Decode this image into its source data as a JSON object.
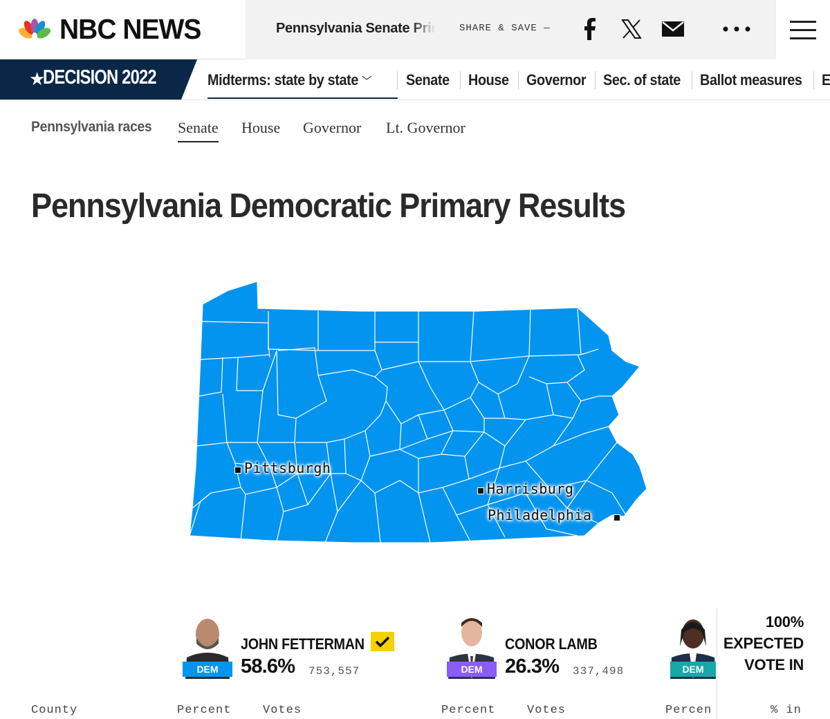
{
  "header": {
    "logo_text": "NBC NEWS",
    "share_title": "Pennsylvania Senate Primary",
    "share_label": "SHARE & SAVE —",
    "icons": [
      "facebook-icon",
      "x-icon",
      "mail-icon",
      "more-icon",
      "menu-icon"
    ]
  },
  "decision_nav": {
    "logo_text": "DECISION 2022",
    "items": [
      {
        "label": "Midterms: state by state"
      },
      {
        "label": "Senate"
      },
      {
        "label": "House"
      },
      {
        "label": "Governor"
      },
      {
        "label": "Sec. of state"
      },
      {
        "label": "Ballot measures"
      },
      {
        "label": "E"
      }
    ]
  },
  "races_nav": {
    "label": "Pennsylvania races",
    "tabs": [
      {
        "label": "Senate",
        "active": true
      },
      {
        "label": "House"
      },
      {
        "label": "Governor"
      },
      {
        "label": "Lt. Governor"
      }
    ]
  },
  "title": "Pennsylvania Democratic Primary Results",
  "map": {
    "fill_color": "#0394f0",
    "cities": [
      {
        "name": "Pittsburgh"
      },
      {
        "name": "Harrisburg"
      },
      {
        "name": "Philadelphia"
      }
    ]
  },
  "candidates": [
    {
      "name": "JOHN FETTERMAN",
      "party": "DEM",
      "percent": "58.6%",
      "votes": "753,557",
      "winner": true,
      "party_color": "#0394f0"
    },
    {
      "name": "CONOR LAMB",
      "party": "DEM",
      "percent": "26.3%",
      "votes": "337,498",
      "winner": false,
      "party_color": "#8b5cf6"
    },
    {
      "name": "",
      "party": "DEM",
      "percent": "",
      "votes": "",
      "winner": false,
      "party_color": "#1aa7a7"
    }
  ],
  "expected_vote": {
    "line1": "100%",
    "line2": "EXPECTED",
    "line3": "VOTE IN"
  },
  "table_headers": [
    "County",
    "Percent",
    "Votes",
    "Percent",
    "Votes",
    "Percen",
    "% in"
  ]
}
